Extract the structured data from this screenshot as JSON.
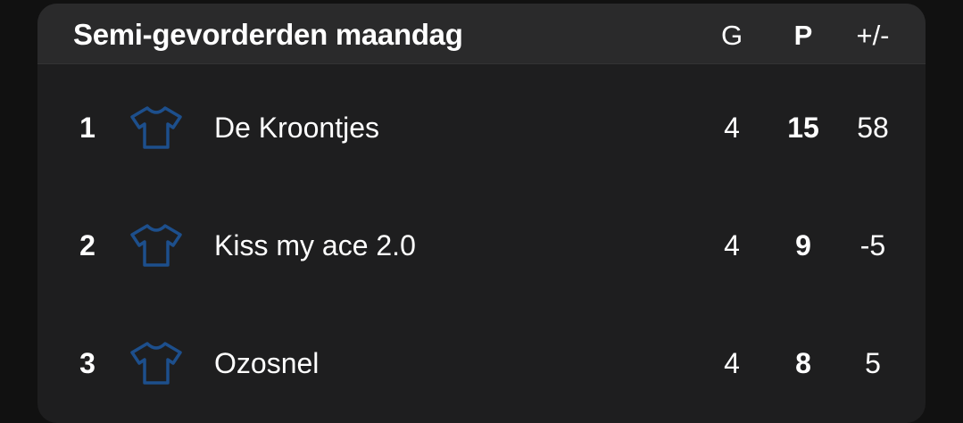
{
  "standings": {
    "title": "Semi-gevorderden maandag",
    "columns": {
      "games": "G",
      "points": "P",
      "diff": "+/-"
    },
    "shirt_color": "#1d4f8c",
    "rows": [
      {
        "rank": "1",
        "team": "De Kroontjes",
        "games": "4",
        "points": "15",
        "diff": "58",
        "icon": "shirt-icon"
      },
      {
        "rank": "2",
        "team": "Kiss my ace 2.0",
        "games": "4",
        "points": "9",
        "diff": "-5",
        "icon": "shirt-icon"
      },
      {
        "rank": "3",
        "team": "Ozosnel",
        "games": "4",
        "points": "8",
        "diff": "5",
        "icon": "shirt-icon"
      }
    ]
  }
}
